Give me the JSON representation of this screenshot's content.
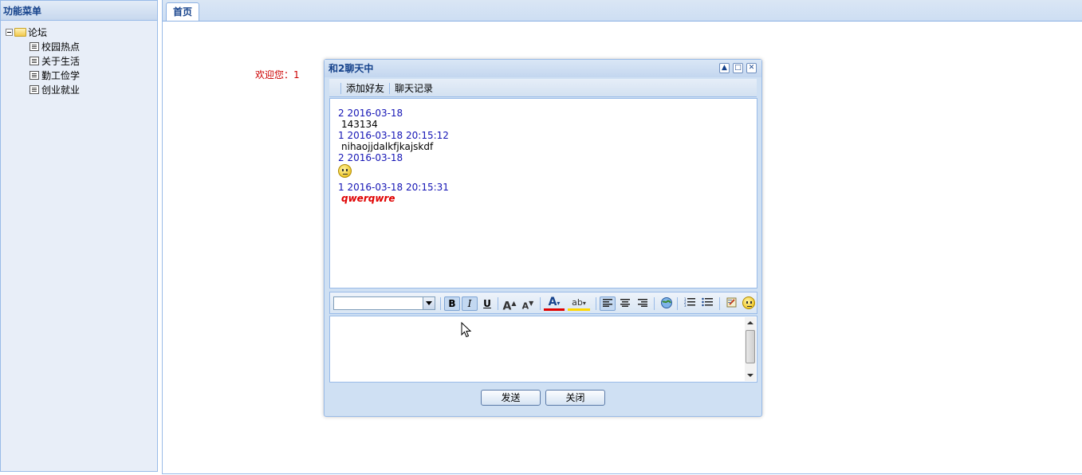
{
  "west": {
    "title": "功能菜单",
    "tree": {
      "root_label": "论坛",
      "items": [
        {
          "label": "校园热点"
        },
        {
          "label": "关于生活"
        },
        {
          "label": "勤工俭学"
        },
        {
          "label": "创业就业"
        }
      ]
    }
  },
  "center": {
    "tabs": [
      {
        "label": "首页"
      }
    ],
    "welcome": "欢迎您：1"
  },
  "chat": {
    "title": "和2聊天中",
    "toolbar": {
      "add_friend": "添加好友",
      "history": "聊天记录"
    },
    "messages": [
      {
        "meta": "2 2016-03-18",
        "body": "143134"
      },
      {
        "meta": "1 2016-03-18 20:15:12",
        "body": "nihaojjdalkfjkajskdf"
      },
      {
        "meta": "2 2016-03-18",
        "body": ""
      },
      {
        "meta": "1 2016-03-18 20:15:31",
        "body": "qwerqwre"
      }
    ],
    "editor_toolbar": {
      "font_value": "",
      "bold": "B",
      "italic": "I",
      "underline": "U",
      "grow": "A",
      "shrink": "A",
      "font_color": "A",
      "highlight": "ab"
    },
    "buttons": {
      "send": "发送",
      "close": "关闭"
    },
    "colors": {
      "accent": "#15428b",
      "meta_text": "#1515b5",
      "emphasis": "#e00000"
    }
  }
}
